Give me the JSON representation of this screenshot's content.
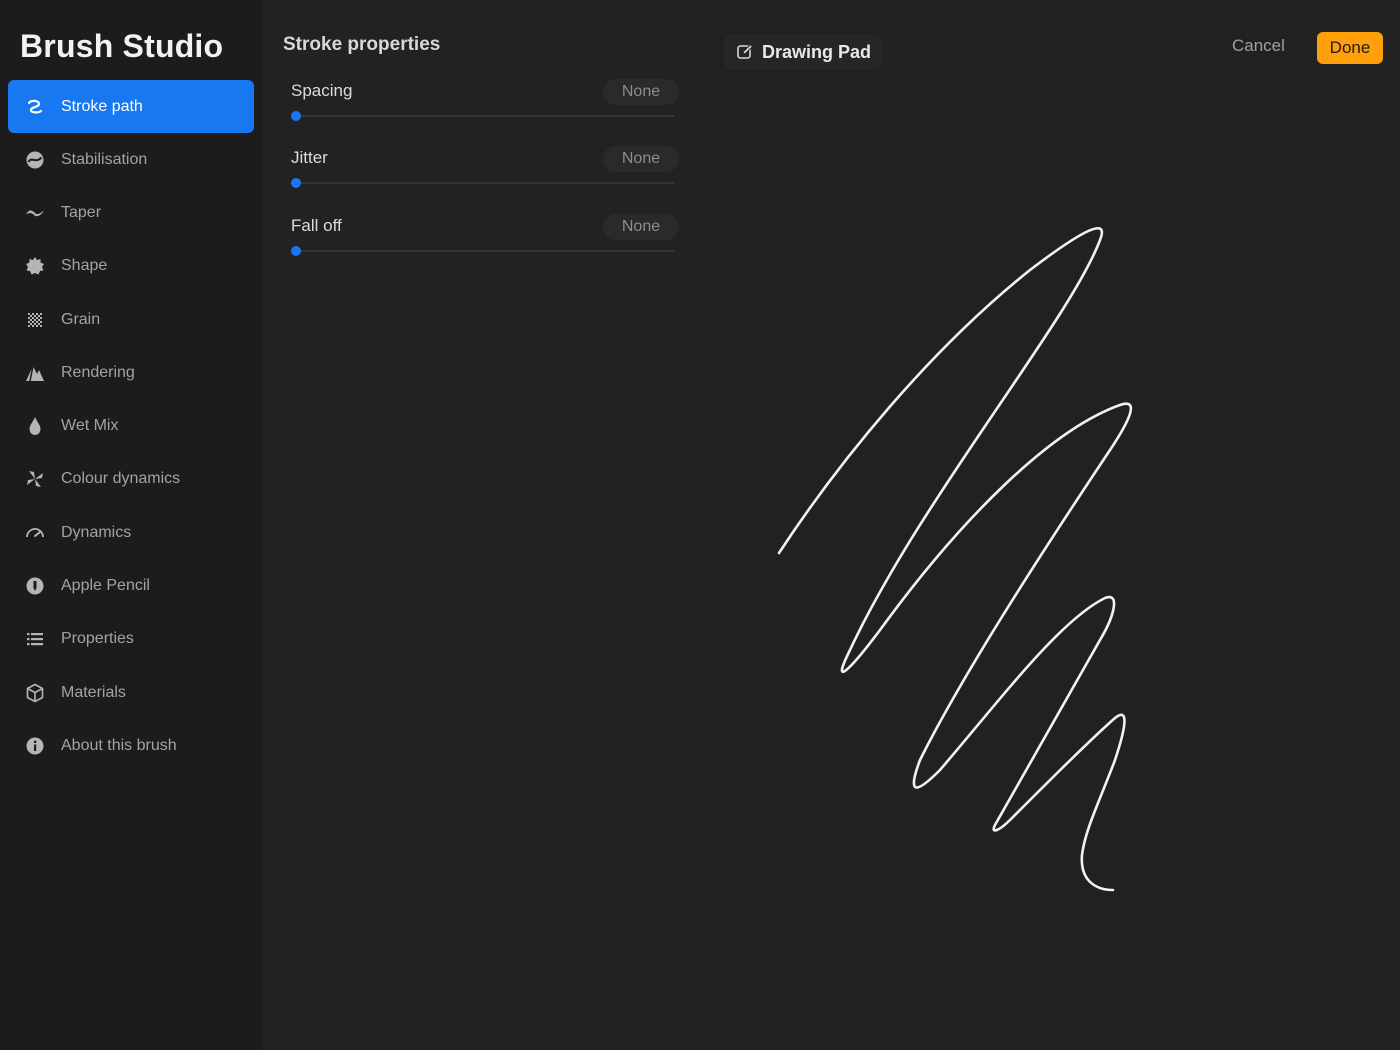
{
  "app": {
    "title": "Brush Studio"
  },
  "sidebar": {
    "items": [
      {
        "label": "Stroke path",
        "icon": "stroke-path-icon",
        "active": true
      },
      {
        "label": "Stabilisation",
        "icon": "stabilisation-icon",
        "active": false
      },
      {
        "label": "Taper",
        "icon": "taper-icon",
        "active": false
      },
      {
        "label": "Shape",
        "icon": "shape-icon",
        "active": false
      },
      {
        "label": "Grain",
        "icon": "grain-icon",
        "active": false
      },
      {
        "label": "Rendering",
        "icon": "rendering-icon",
        "active": false
      },
      {
        "label": "Wet Mix",
        "icon": "wet-mix-icon",
        "active": false
      },
      {
        "label": "Colour dynamics",
        "icon": "colour-dynamics-icon",
        "active": false
      },
      {
        "label": "Dynamics",
        "icon": "dynamics-icon",
        "active": false
      },
      {
        "label": "Apple Pencil",
        "icon": "apple-pencil-icon",
        "active": false
      },
      {
        "label": "Properties",
        "icon": "properties-icon",
        "active": false
      },
      {
        "label": "Materials",
        "icon": "materials-icon",
        "active": false
      },
      {
        "label": "About this brush",
        "icon": "info-icon",
        "active": false
      }
    ]
  },
  "properties": {
    "title": "Stroke properties",
    "settings": [
      {
        "label": "Spacing",
        "value": "None",
        "level": 0
      },
      {
        "label": "Jitter",
        "value": "None",
        "level": 0
      },
      {
        "label": "Fall off",
        "value": "None",
        "level": 0
      }
    ]
  },
  "pad": {
    "title": "Drawing Pad",
    "title_icon": "edit-icon",
    "cancel_label": "Cancel",
    "done_label": "Done"
  },
  "colors": {
    "accent": "#1778f2",
    "done": "#ff9f0a",
    "background": "#1b1b1c"
  }
}
